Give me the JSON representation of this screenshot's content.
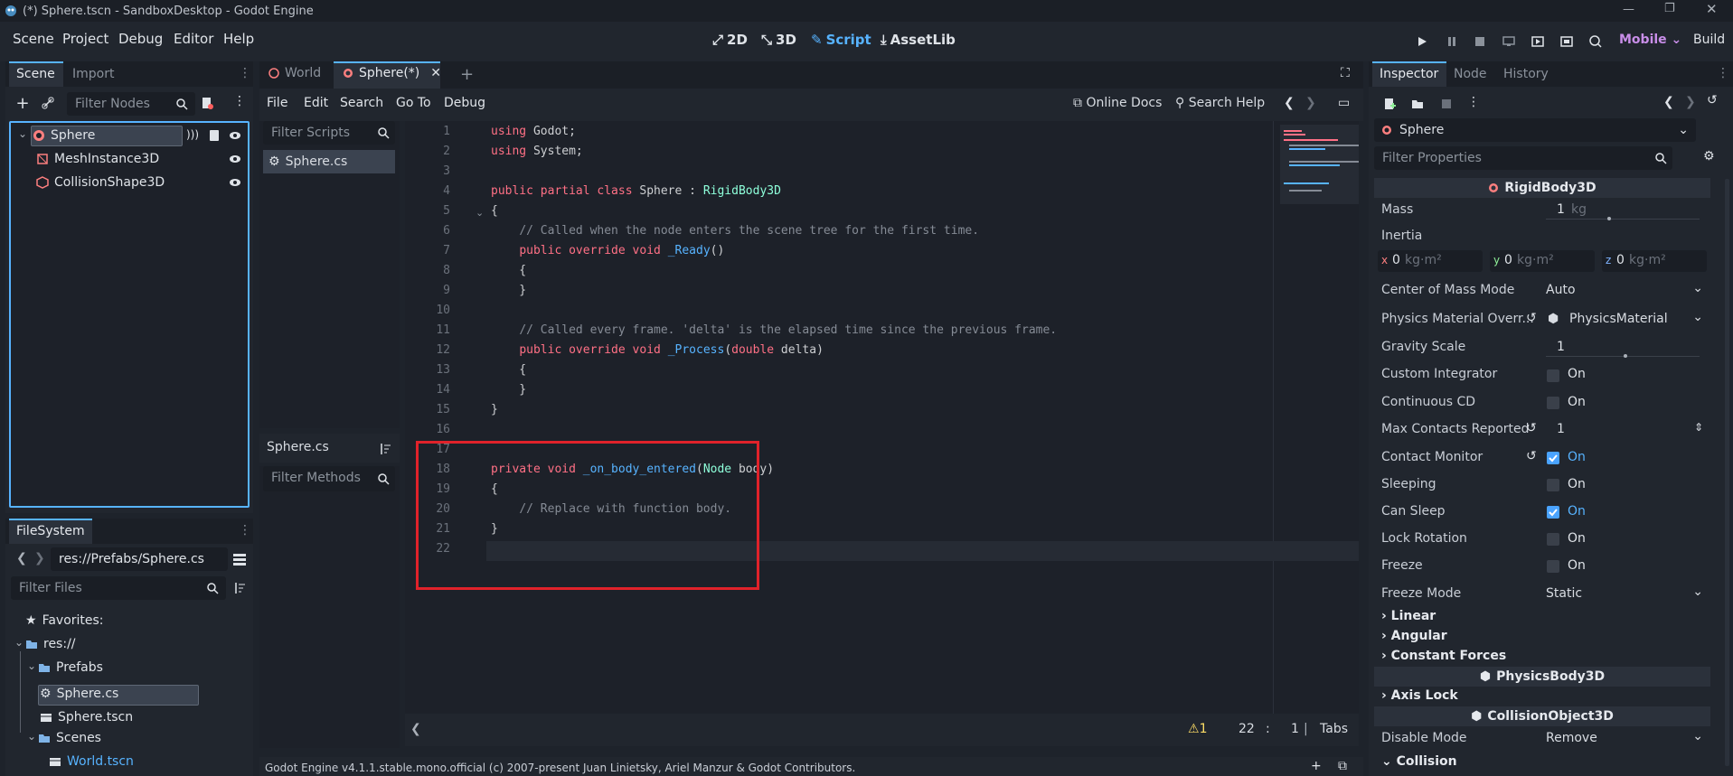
{
  "titlebar": {
    "title": "(*) Sphere.tscn - SandboxDesktop - Godot Engine"
  },
  "menu": {
    "items": [
      "Scene",
      "Project",
      "Debug",
      "Editor",
      "Help"
    ]
  },
  "workspaces": {
    "w2d": "2D",
    "w3d": "3D",
    "script": "Script",
    "assetlib": "AssetLib"
  },
  "run": {
    "renderer": "Mobile",
    "build": "Build"
  },
  "scene_dock": {
    "tabs": [
      "Scene",
      "Import"
    ],
    "filter_placeholder": "Filter Nodes",
    "nodes": [
      "Sphere",
      "MeshInstance3D",
      "CollisionShape3D"
    ]
  },
  "filesystem": {
    "tab": "FileSystem",
    "path": "res://Prefabs/Sphere.cs",
    "filter_placeholder": "Filter Files",
    "items": [
      "Favorites:",
      "res://",
      "Prefabs",
      "Sphere.cs",
      "Sphere.tscn",
      "Scenes",
      "World.tscn"
    ]
  },
  "editor_tabs": [
    "World",
    "Sphere(*)"
  ],
  "script_menu": {
    "items": [
      "File",
      "Edit",
      "Search",
      "Go To",
      "Debug"
    ],
    "online_docs": "Online Docs",
    "search_help": "Search Help"
  },
  "script_list": {
    "filter_placeholder": "Filter Scripts",
    "items": [
      "Sphere.cs"
    ],
    "current": "Sphere.cs",
    "filter_methods": "Filter Methods"
  },
  "code": {
    "line_numbers": [
      "1",
      "2",
      "3",
      "4",
      "5",
      "6",
      "7",
      "8",
      "9",
      "10",
      "11",
      "12",
      "13",
      "14",
      "15",
      "16",
      "17",
      "18",
      "19",
      "20",
      "21",
      "22"
    ]
  },
  "status": {
    "warnings": "1",
    "line": "22",
    "col": "1",
    "indent": "Tabs"
  },
  "output": {
    "text": "Godot Engine v4.1.1.stable.mono.official (c) 2007-present Juan Linietsky, Ariel Manzur & Godot Contributors."
  },
  "inspector": {
    "tabs": [
      "Inspector",
      "Node",
      "History"
    ],
    "object": "Sphere",
    "filter_placeholder": "Filter Properties",
    "section_rigid": "RigidBody3D",
    "mass_label": "Mass",
    "mass_value": "1",
    "mass_unit": "kg",
    "inertia_label": "Inertia",
    "inertia": [
      {
        "axis": "x",
        "value": "0",
        "unit": "kg·m²"
      },
      {
        "axis": "y",
        "value": "0",
        "unit": "kg·m²"
      },
      {
        "axis": "z",
        "value": "0",
        "unit": "kg·m²"
      }
    ],
    "com_label": "Center of Mass Mode",
    "com_value": "Auto",
    "pmo_label": "Physics Material Overr...",
    "pmo_value": "PhysicsMaterial",
    "gravity_label": "Gravity Scale",
    "gravity_value": "1",
    "ci_label": "Custom Integrator",
    "cont_cd_label": "Continuous CD",
    "max_contacts_label": "Max Contacts Reported",
    "max_contacts_value": "1",
    "contact_monitor_label": "Contact Monitor",
    "sleeping_label": "Sleeping",
    "can_sleep_label": "Can Sleep",
    "lock_rotation_label": "Lock Rotation",
    "freeze_label": "Freeze",
    "on": "On",
    "freeze_mode_label": "Freeze Mode",
    "freeze_mode_value": "Static",
    "linear": "Linear",
    "angular": "Angular",
    "constant_forces": "Constant Forces",
    "section_physics": "PhysicsBody3D",
    "axis_lock": "Axis Lock",
    "section_collision": "CollisionObject3D",
    "disable_mode_label": "Disable Mode",
    "disable_mode_value": "Remove",
    "collision": "Collision"
  },
  "colors": {
    "accent": "#57b3ff",
    "highlight_box": "#e0222a",
    "background": "#1e232b"
  }
}
